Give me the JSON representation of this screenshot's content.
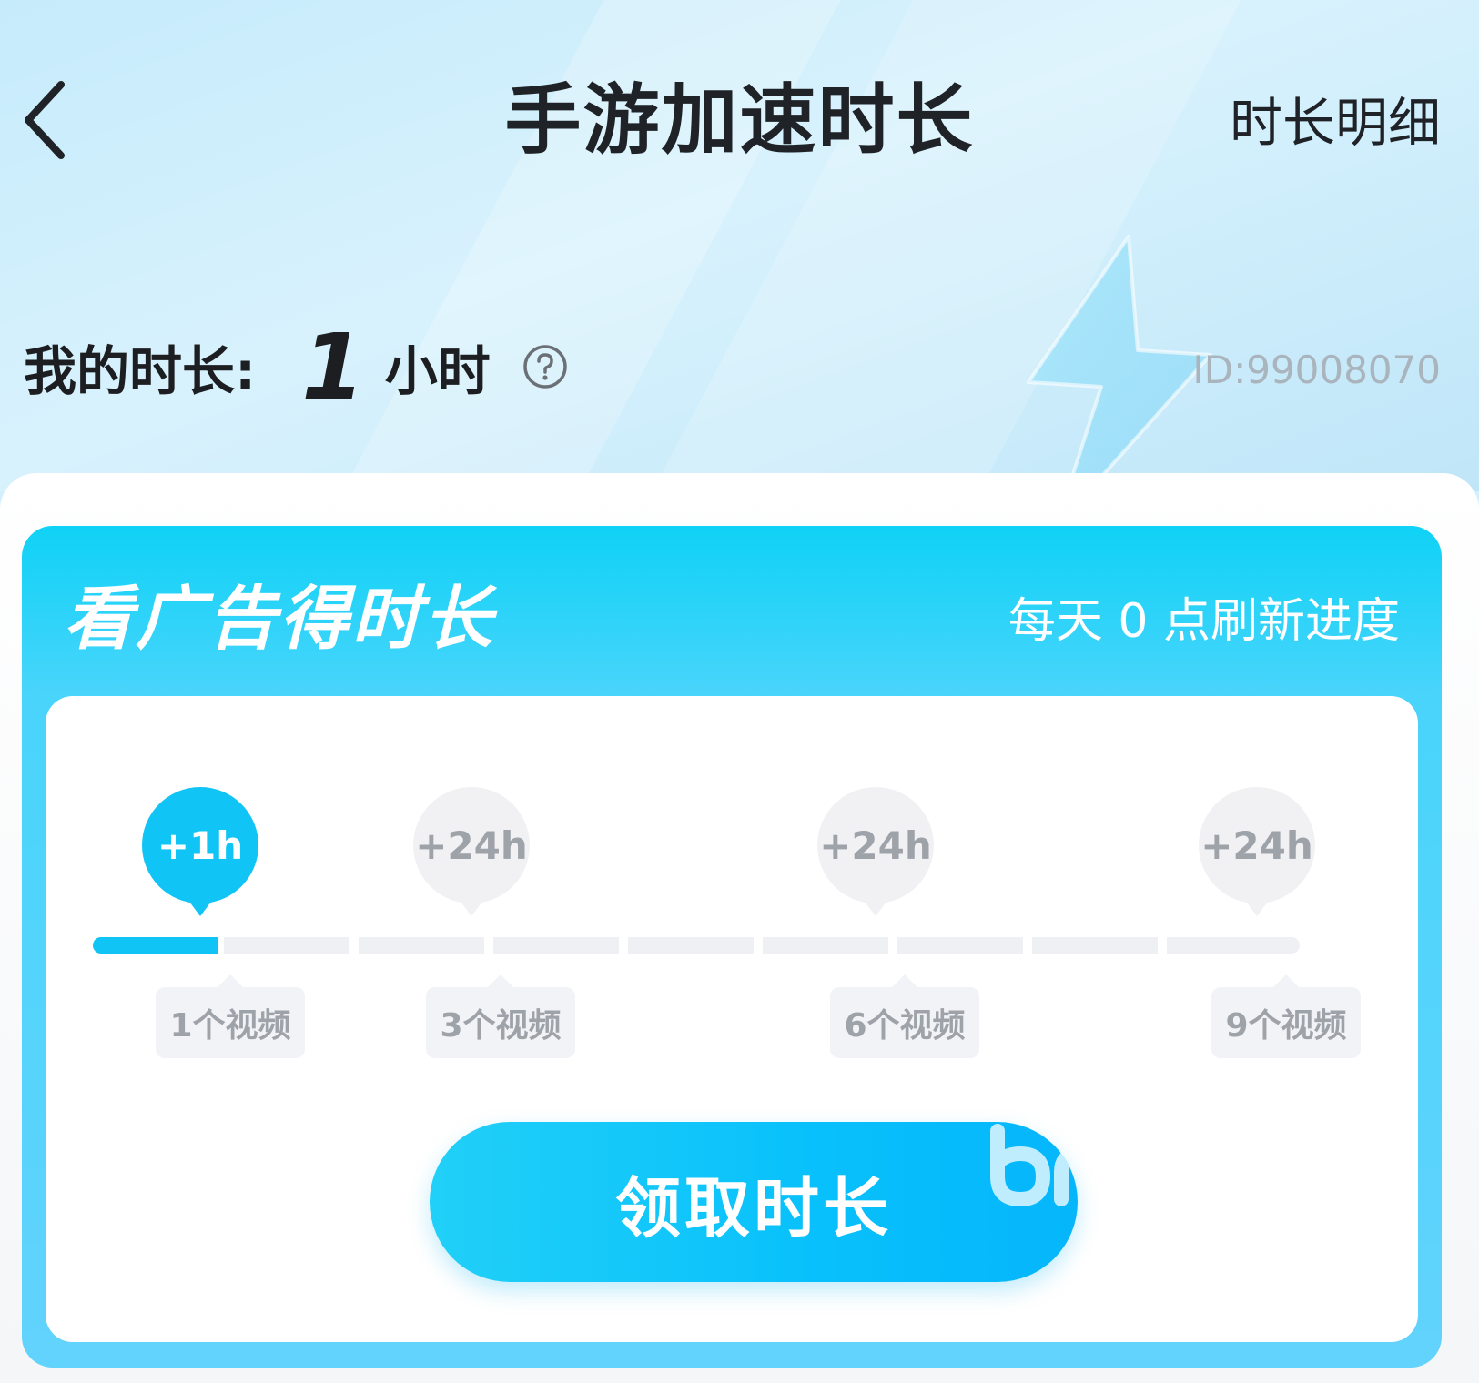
{
  "header": {
    "title": "手游加速时长",
    "detail_link": "时长明细"
  },
  "balance": {
    "label": "我的时长:",
    "value": "1",
    "unit": "小时",
    "user_id": "ID:99008070"
  },
  "task_card": {
    "title": "看广告得时长",
    "refresh_note": "每天 0 点刷新进度",
    "progress": {
      "total_segments": 9,
      "completed_segments": 1
    },
    "milestones": [
      {
        "reward": "+1h",
        "requirement": "1个视频",
        "reached": true
      },
      {
        "reward": "+24h",
        "requirement": "3个视频",
        "reached": false
      },
      {
        "reward": "+24h",
        "requirement": "6个视频",
        "reached": false
      },
      {
        "reward": "+24h",
        "requirement": "9个视频",
        "reached": false
      }
    ],
    "claim_button": "领取时长"
  },
  "colors": {
    "accent": "#10c5f6",
    "title_text": "#1f2226",
    "inactive_text": "#9ea2a9",
    "inactive_fill": "#eff0f4"
  }
}
